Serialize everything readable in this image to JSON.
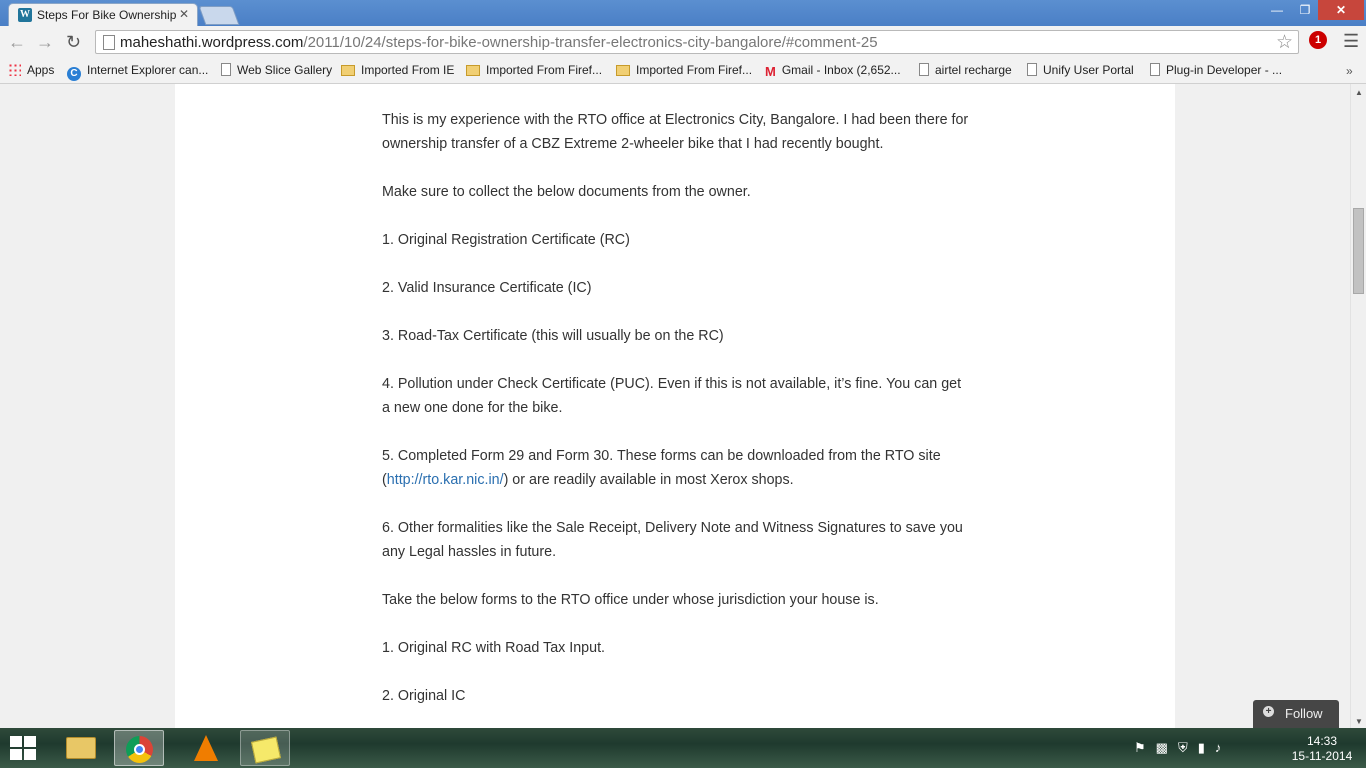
{
  "browser": {
    "tab_title": "Steps For Bike Ownership",
    "tab_close": "✕",
    "url_domain": "maheshathi.wordpress.com",
    "url_path": "/2011/10/24/steps-for-bike-ownership-transfer-electronics-city-bangalore/#comment-25",
    "window_min": "—",
    "window_max": "❐",
    "window_close": "✕",
    "extension_badge": "1"
  },
  "bookmarks": [
    {
      "label": "Apps",
      "icon": "apps-icon"
    },
    {
      "label": "Internet Explorer can...",
      "icon": "c-icon"
    },
    {
      "label": "Web Slice Gallery",
      "icon": "page-icon"
    },
    {
      "label": "Imported From IE",
      "icon": "folder-icon"
    },
    {
      "label": "Imported From Firef...",
      "icon": "folder-icon"
    },
    {
      "label": "Imported From Firef...",
      "icon": "folder-icon"
    },
    {
      "label": "Gmail - Inbox (2,652...",
      "icon": "gmail-icon"
    },
    {
      "label": "airtel recharge",
      "icon": "page-icon"
    },
    {
      "label": "Unify User Portal",
      "icon": "page-icon"
    },
    {
      "label": "Plug-in Developer - ...",
      "icon": "page-icon"
    }
  ],
  "article": {
    "p1": "This is my experience with the RTO office at Electronics City, Bangalore. I had been there for ownership transfer of a CBZ Extreme 2-wheeler bike that I had recently bought.",
    "p2": "Make sure to collect the below documents from the owner.",
    "p3": "1. Original Registration Certificate (RC)",
    "p4": "2. Valid Insurance Certificate (IC)",
    "p5": "3. Road-Tax Certificate (this will usually be on the RC)",
    "p6": "4. Pollution under Check Certificate (PUC). Even if this is not available, it’s fine. You can get a new one done for the bike.",
    "p7_before": "5. Completed Form 29 and Form 30. These forms can be downloaded from the RTO site (",
    "p7_link": "http://rto.kar.nic.in/",
    "p7_after": ") or are readily available in most Xerox shops.",
    "p8": "6. Other formalities like the Sale Receipt, Delivery Note and Witness Signatures to save you any Legal hassles in future.",
    "p9": "Take the below forms to the RTO office under whose jurisdiction your house is.",
    "p10": "1. Original RC with Road Tax Input.",
    "p11": "2. Original IC"
  },
  "follow": {
    "label": "Follow"
  },
  "taskbar": {
    "time": "14:33",
    "date": "15-11-2014"
  }
}
